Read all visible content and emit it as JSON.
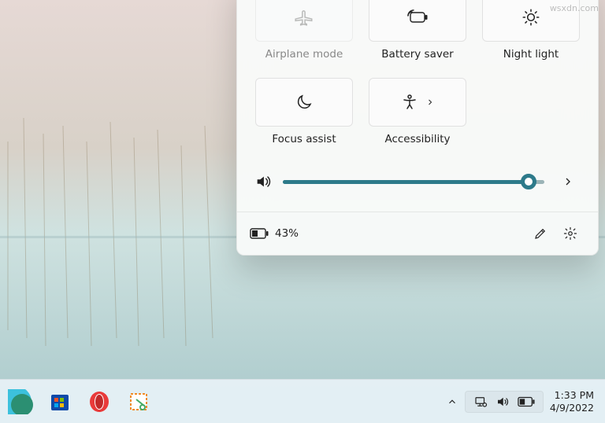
{
  "watermark": "wsxdn.com",
  "panel": {
    "tiles": [
      {
        "id": "airplane",
        "label": "Airplane mode",
        "disabled": true
      },
      {
        "id": "battery-saver",
        "label": "Battery saver",
        "disabled": false
      },
      {
        "id": "night-light",
        "label": "Night light",
        "disabled": false
      },
      {
        "id": "focus-assist",
        "label": "Focus assist",
        "disabled": false
      },
      {
        "id": "accessibility",
        "label": "Accessibility",
        "disabled": false,
        "has_submenu": true
      }
    ],
    "volume": {
      "percent": 94
    },
    "battery": {
      "percent_text": "43%"
    },
    "colors": {
      "accent": "#2d7a8a"
    }
  },
  "taskbar": {
    "tray": {
      "network": "network-icon",
      "volume": "speaker-icon",
      "battery": "battery-icon"
    },
    "clock": {
      "time": "1:33 PM",
      "date": "4/9/2022"
    }
  }
}
